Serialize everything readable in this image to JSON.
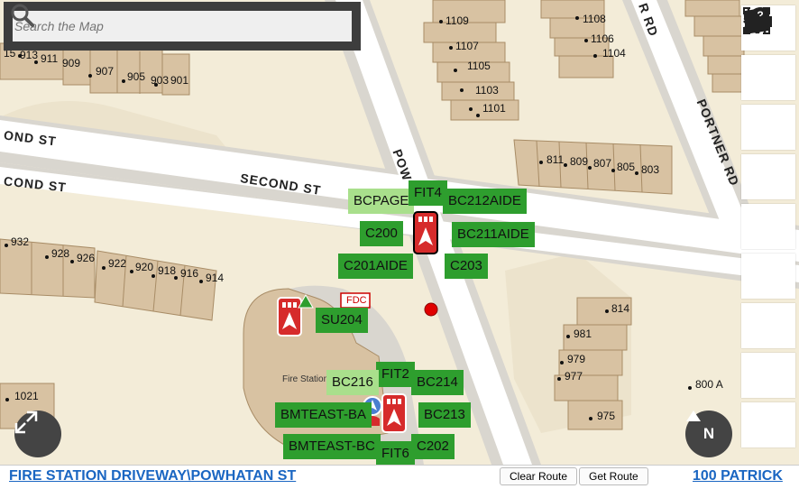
{
  "search": {
    "placeholder": "Search the Map"
  },
  "toolbar": {
    "tools": [
      {
        "name": "layers-icon"
      },
      {
        "name": "locate-frame-icon"
      },
      {
        "name": "navigation-arrow-icon"
      },
      {
        "name": "zoom-in-icon"
      },
      {
        "name": "zoom-out-icon"
      },
      {
        "name": "settings-sliders-icon"
      },
      {
        "name": "map-star-icon"
      },
      {
        "name": "help-cursor-icon"
      },
      {
        "name": "drawer-icon"
      }
    ]
  },
  "streets": {
    "second_st_left_top": "OND ST",
    "second_st_left_bottom": "COND ST",
    "second_st_center": "SECOND ST",
    "powhatan": "POW",
    "portner": "PORTNER RD",
    "top_rd": "R RD"
  },
  "addresses": {
    "a1109": "1109",
    "a1107": "1107",
    "a1105": "1105",
    "a1103": "1103",
    "a1101": "1101",
    "a1108": "1108",
    "a1106": "1106",
    "a1104": "1104",
    "a913": "913",
    "a911": "911",
    "a909": "909",
    "a15": "15",
    "a907": "907",
    "a905": "905",
    "a903": "903",
    "a901": "901",
    "a811": "811",
    "a809": "809",
    "a807": "807",
    "a805": "805",
    "a803": "803",
    "a932": "932",
    "a928": "928",
    "a926": "926",
    "a922": "922",
    "a920": "920",
    "a918": "918",
    "a916": "916",
    "a914": "914",
    "a814": "814",
    "a981": "981",
    "a979": "979",
    "a977": "977",
    "a975": "975",
    "a800": "800  A",
    "a1021": "1021"
  },
  "map_labels": {
    "fire_station": "Fire Station",
    "fdc": "FDC"
  },
  "units": [
    {
      "id": "BCPAGE",
      "light": true
    },
    {
      "id": "FIT4",
      "light": false
    },
    {
      "id": "BC212AIDE",
      "light": false
    },
    {
      "id": "C200",
      "light": false
    },
    {
      "id": "BC211AIDE",
      "light": false
    },
    {
      "id": "C201AIDE",
      "light": false
    },
    {
      "id": "C203",
      "light": false
    },
    {
      "id": "SU204",
      "light": false
    },
    {
      "id": "FIT2",
      "light": false
    },
    {
      "id": "BC216",
      "light": true
    },
    {
      "id": "BC214",
      "light": false
    },
    {
      "id": "BMTEAST-BA",
      "light": false
    },
    {
      "id": "BC213",
      "light": false
    },
    {
      "id": "BMTEAST-BC",
      "light": false
    },
    {
      "id": "C202",
      "light": false
    },
    {
      "id": "FIT6",
      "light": false
    }
  ],
  "compass": {
    "label": "N"
  },
  "status": {
    "location": "FIRE STATION DRIVEWAY\\POWHATAN ST",
    "clear_route": "Clear Route",
    "get_route": "Get Route",
    "destination": "100 PATRICK"
  },
  "colors": {
    "unit_green": "#2e9e2e",
    "unit_light_green": "#a9df8c",
    "vehicle_red": "#d62b2b",
    "incident_red": "#e00000",
    "building_tan": "#d8c2a2",
    "road_white": "#ffffff",
    "link_blue": "#1a66c2"
  }
}
